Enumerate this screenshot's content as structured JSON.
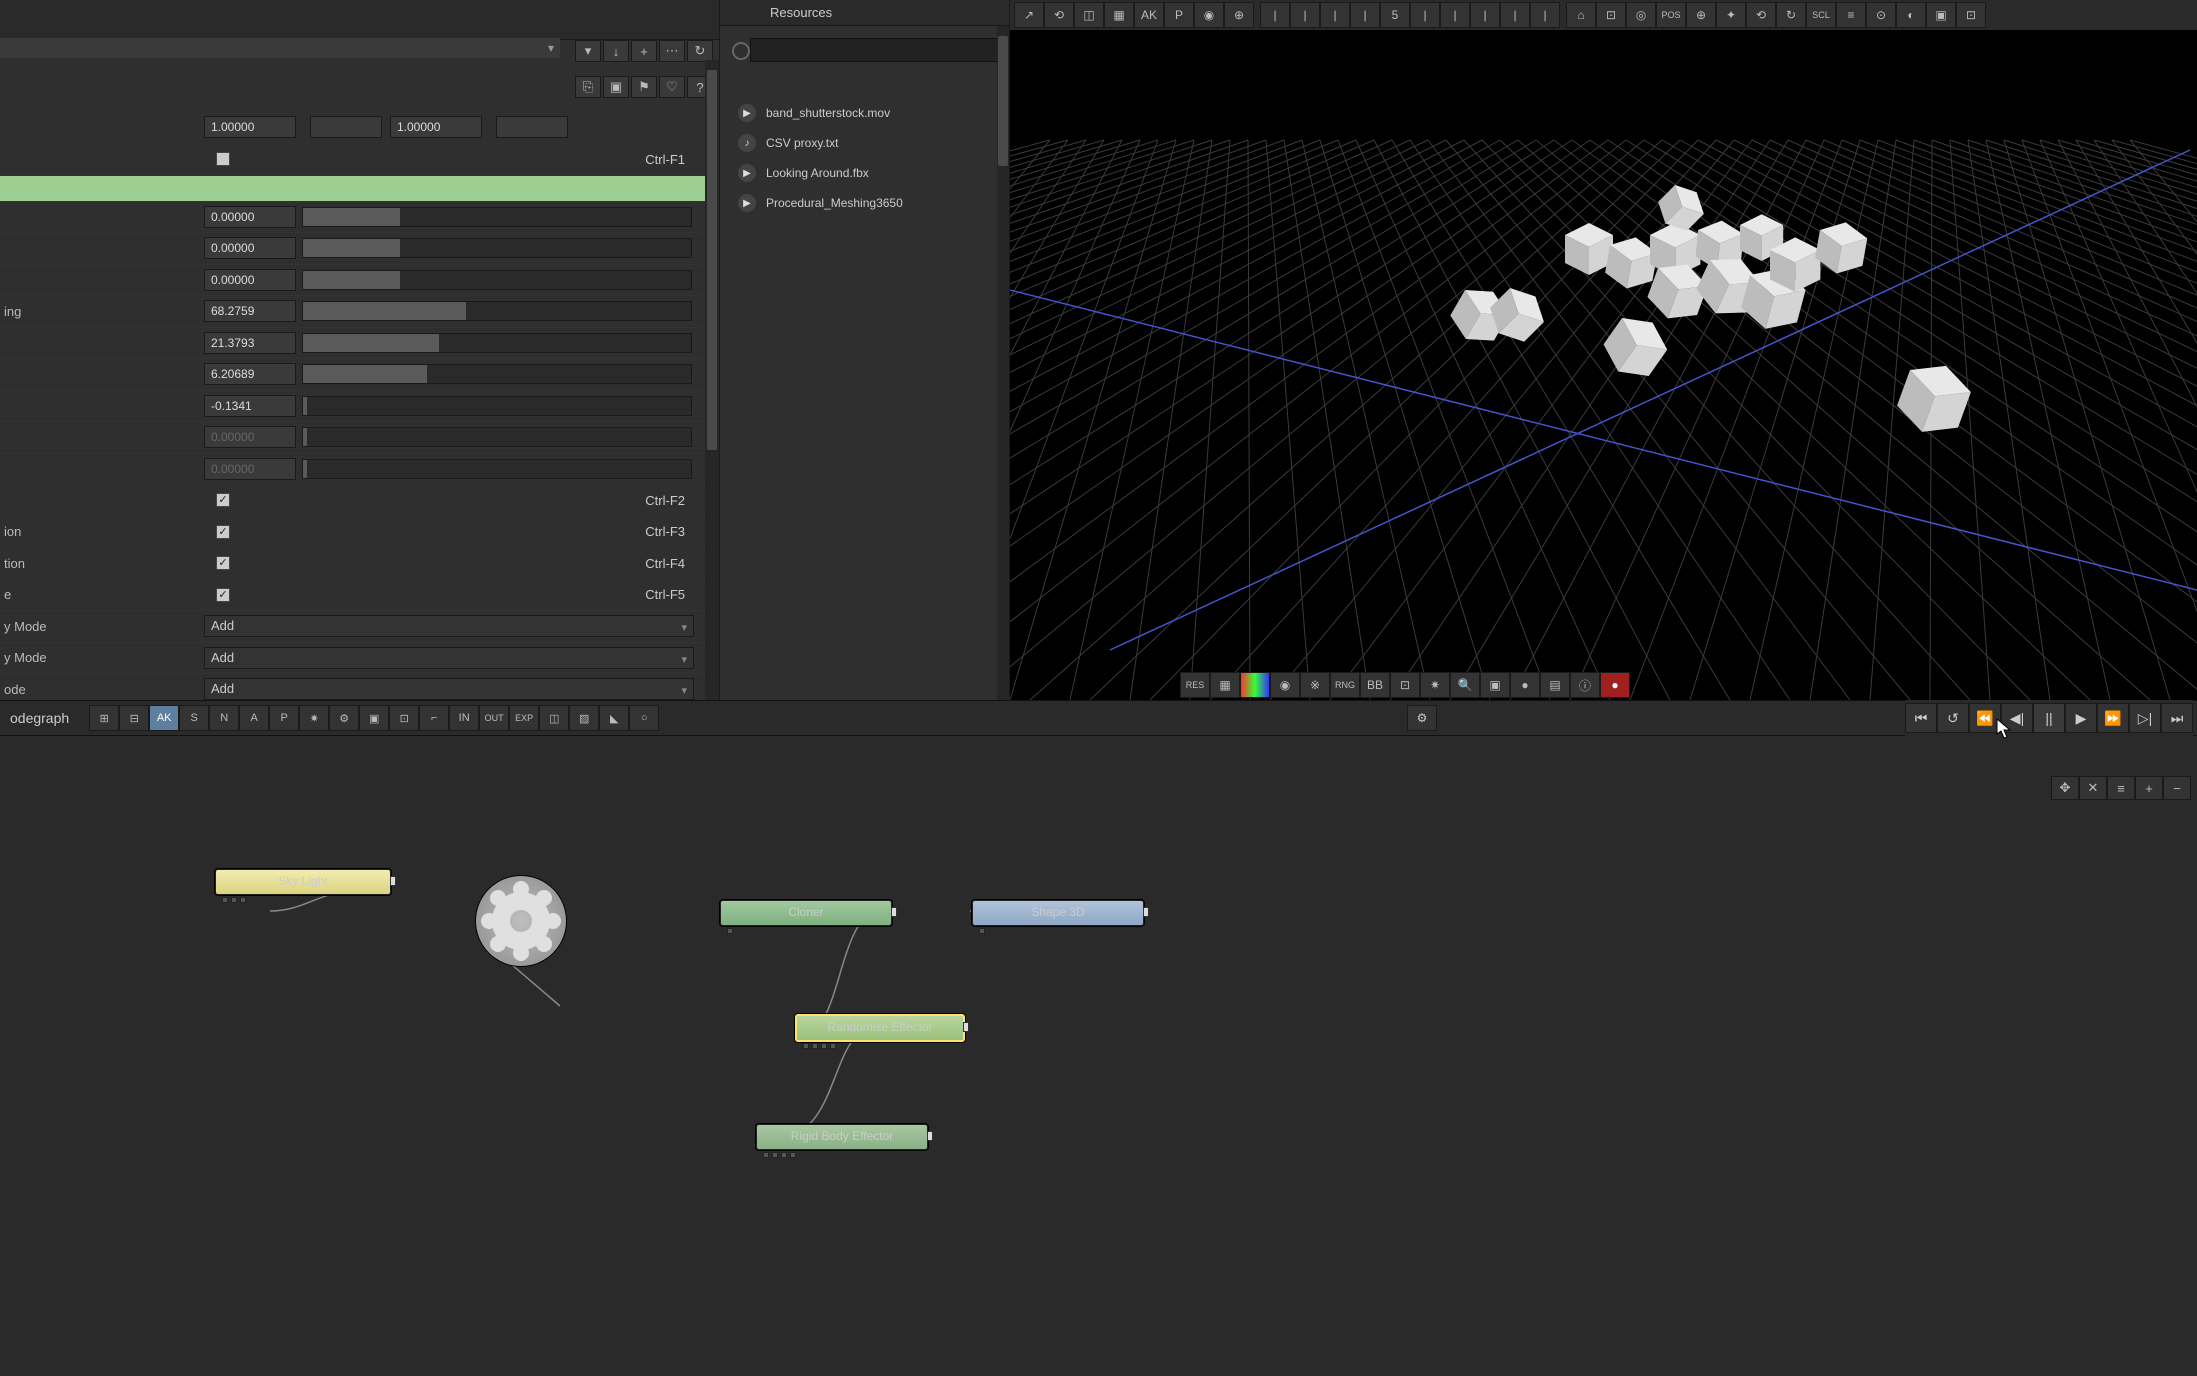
{
  "resources": {
    "title": "Resources",
    "items": [
      {
        "icon": "▶",
        "label": "band_shutterstock.mov",
        "active": true,
        "type": "video"
      },
      {
        "icon": "♪",
        "label": "CSV proxy.txt",
        "active": false,
        "type": "text"
      },
      {
        "icon": "▶",
        "label": "Looking Around.fbx",
        "active": false,
        "type": "model"
      },
      {
        "icon": "▶",
        "label": "Procedural_Meshing3650",
        "active": false,
        "type": "asset"
      }
    ]
  },
  "properties": {
    "mini_toolbar1": [
      {
        "glyph": "▾",
        "name": "expand"
      },
      {
        "glyph": "↓",
        "name": "down"
      },
      {
        "glyph": "+",
        "name": "add"
      },
      {
        "glyph": "⋯",
        "name": "more"
      },
      {
        "glyph": "↻",
        "name": "refresh"
      }
    ],
    "mini_toolbar2": [
      {
        "glyph": "⎘",
        "name": "copy"
      },
      {
        "glyph": "▣",
        "name": "paste"
      },
      {
        "glyph": "⚑",
        "name": "flag"
      },
      {
        "glyph": "♡",
        "name": "fav"
      },
      {
        "glyph": "?",
        "name": "help"
      }
    ],
    "header_values": {
      "a": "1.00000",
      "b": "1.00000"
    },
    "rows": [
      {
        "type": "check",
        "label": "",
        "checked": false,
        "hotkey": "Ctrl-F1"
      },
      {
        "type": "greenbar"
      },
      {
        "type": "num",
        "label": "",
        "value": "0.00000",
        "fill": 25
      },
      {
        "type": "num",
        "label": "",
        "value": "0.00000",
        "fill": 25
      },
      {
        "type": "num",
        "label": "",
        "value": "0.00000",
        "fill": 25
      },
      {
        "type": "num",
        "label": "ing",
        "value": "68.2759",
        "fill": 42
      },
      {
        "type": "num",
        "label": "",
        "value": "21.3793",
        "fill": 35
      },
      {
        "type": "num",
        "label": "",
        "value": "6.20689",
        "fill": 32
      },
      {
        "type": "num",
        "label": "",
        "value": "-0.1341",
        "fill": 1
      },
      {
        "type": "num",
        "label": "",
        "value": "0.00000",
        "fill": 1,
        "disabled": true
      },
      {
        "type": "num",
        "label": "",
        "value": "0.00000",
        "fill": 1,
        "disabled": true
      },
      {
        "type": "check",
        "label": "",
        "checked": true,
        "hotkey": "Ctrl-F2"
      },
      {
        "type": "check",
        "label": "ion",
        "checked": true,
        "hotkey": "Ctrl-F3"
      },
      {
        "type": "check",
        "label": "tion",
        "checked": true,
        "hotkey": "Ctrl-F4"
      },
      {
        "type": "check",
        "label": "e",
        "checked": true,
        "hotkey": "Ctrl-F5"
      },
      {
        "type": "dd",
        "label": "y Mode",
        "value": "Add"
      },
      {
        "type": "dd",
        "label": "y Mode",
        "value": "Add"
      },
      {
        "type": "dd",
        "label": "ode",
        "value": "Add"
      }
    ]
  },
  "viewport": {
    "top_toolbar": [
      {
        "g": "↗",
        "n": "move"
      },
      {
        "g": "⟲",
        "n": "rotate"
      },
      {
        "g": "◫",
        "n": "scale"
      },
      {
        "g": "▦",
        "n": "snap"
      },
      {
        "g": "AK",
        "n": "ak"
      },
      {
        "g": "P",
        "n": "p"
      },
      {
        "g": "◉",
        "n": "target"
      },
      {
        "g": "⊕",
        "n": "pivot"
      },
      {
        "g": "",
        "n": "sep"
      },
      {
        "g": "|",
        "n": "t1"
      },
      {
        "g": "|",
        "n": "t2"
      },
      {
        "g": "|",
        "n": "t3"
      },
      {
        "g": "|",
        "n": "t4"
      },
      {
        "g": "5",
        "n": "frame"
      },
      {
        "g": "|",
        "n": "t5"
      },
      {
        "g": "|",
        "n": "t6"
      },
      {
        "g": "|",
        "n": "t7"
      },
      {
        "g": "|",
        "n": "t8"
      },
      {
        "g": "|",
        "n": "t9"
      },
      {
        "g": "",
        "n": "sep2"
      },
      {
        "g": "⌂",
        "n": "home"
      },
      {
        "g": "⊡",
        "n": "frame-sel"
      },
      {
        "g": "◎",
        "n": "focus"
      },
      {
        "g": "POS",
        "n": "pos"
      },
      {
        "g": "⊕",
        "n": "trans"
      },
      {
        "g": "✦",
        "n": "gizmo"
      },
      {
        "g": "⟲",
        "n": "rot"
      },
      {
        "g": "↻",
        "n": "spin"
      },
      {
        "g": "SCL",
        "n": "scl"
      },
      {
        "g": "≡",
        "n": "list"
      },
      {
        "g": "⊙",
        "n": "lens"
      },
      {
        "g": "◐",
        "n": "shade"
      },
      {
        "g": "▣",
        "n": "cam"
      },
      {
        "g": "⊡",
        "n": "full"
      }
    ],
    "mid_toolbar": [
      {
        "g": "RES",
        "n": "res"
      },
      {
        "g": "▦",
        "n": "grid"
      },
      {
        "g": "▮",
        "n": "color",
        "cls": "color"
      },
      {
        "g": "◉",
        "n": "dof"
      },
      {
        "g": "※",
        "n": "wireframe"
      },
      {
        "g": "RNG",
        "n": "rng"
      },
      {
        "g": "BB",
        "n": "bbox"
      },
      {
        "g": "⊡",
        "n": "tex"
      },
      {
        "g": "✷",
        "n": "light"
      },
      {
        "g": "🔍",
        "n": "zoom"
      },
      {
        "g": "▣",
        "n": "safe"
      },
      {
        "g": "●",
        "n": "sphere"
      },
      {
        "g": "▤",
        "n": "layers"
      },
      {
        "g": "ⓘ",
        "n": "info"
      },
      {
        "g": "●",
        "n": "rec",
        "cls": "rec"
      }
    ]
  },
  "nodegraph": {
    "label": "odegraph",
    "toolbar": [
      {
        "g": "⊞",
        "n": "grp1"
      },
      {
        "g": "⊟",
        "n": "grp2"
      },
      {
        "g": "AK",
        "n": "ak",
        "active": true
      },
      {
        "g": "S",
        "n": "s"
      },
      {
        "g": "N",
        "n": "n"
      },
      {
        "g": "A",
        "n": "a"
      },
      {
        "g": "P",
        "n": "p"
      },
      {
        "g": "✷",
        "n": "fx"
      },
      {
        "g": "⚙",
        "n": "gear"
      },
      {
        "g": "▣",
        "n": "box"
      },
      {
        "g": "⊡",
        "n": "sel"
      },
      {
        "g": "⌐",
        "n": "l"
      },
      {
        "g": "IN",
        "n": "in"
      },
      {
        "g": "OUT",
        "n": "out"
      },
      {
        "g": "EXP",
        "n": "exp"
      },
      {
        "g": "◫",
        "n": "split"
      },
      {
        "g": "▨",
        "n": "hatch"
      },
      {
        "g": "◣",
        "n": "tri"
      },
      {
        "g": "○",
        "n": "circ"
      }
    ],
    "gear_right": {
      "g": "⚙",
      "n": "settings"
    },
    "nodes": {
      "sky": {
        "label": "Sky  Light"
      },
      "cloner": {
        "label": "Cloner"
      },
      "shape": {
        "label": "Shape  3D"
      },
      "rand": {
        "label": "Randomise  Effector"
      },
      "rigid": {
        "label": "Rigid  Body  Effector"
      }
    }
  },
  "playback": {
    "buttons": [
      {
        "g": "⏮",
        "n": "first"
      },
      {
        "g": "↺",
        "n": "loop"
      },
      {
        "g": "⏪",
        "n": "rew"
      },
      {
        "g": "◀|",
        "n": "step-back"
      },
      {
        "g": "||",
        "n": "pause",
        "active": true
      },
      {
        "g": "▶",
        "n": "play"
      },
      {
        "g": "⏩",
        "n": "ffwd"
      },
      {
        "g": "▷|",
        "n": "step-fwd"
      },
      {
        "g": "⏭",
        "n": "last"
      }
    ],
    "zoom": [
      {
        "g": "✥",
        "n": "pan"
      },
      {
        "g": "✕",
        "n": "close"
      },
      {
        "g": "≡",
        "n": "fit"
      },
      {
        "g": "+",
        "n": "in"
      },
      {
        "g": "−",
        "n": "out"
      }
    ]
  }
}
